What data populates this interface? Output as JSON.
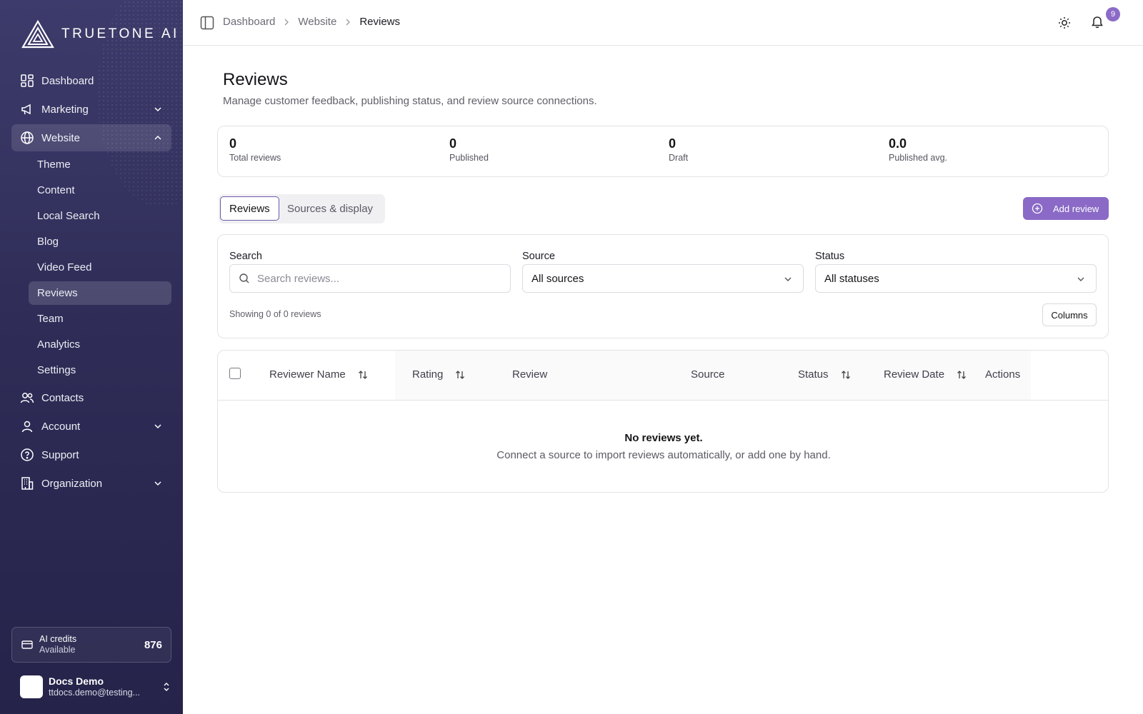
{
  "brand": {
    "name": "TRUETONE AI"
  },
  "sidebar": {
    "items": [
      {
        "label": "Dashboard",
        "icon": "dashboard-icon"
      },
      {
        "label": "Marketing",
        "icon": "megaphone-icon",
        "expandable": true
      },
      {
        "label": "Website",
        "icon": "globe-icon",
        "expandable": true,
        "expanded": true
      },
      {
        "label": "Contacts",
        "icon": "users-icon"
      },
      {
        "label": "Account",
        "icon": "user-icon",
        "expandable": true
      },
      {
        "label": "Support",
        "icon": "help-circle-icon"
      },
      {
        "label": "Organization",
        "icon": "building-icon",
        "expandable": true
      }
    ],
    "website_sub": [
      "Theme",
      "Content",
      "Local Search",
      "Blog",
      "Video Feed",
      "Reviews",
      "Team",
      "Analytics",
      "Settings"
    ],
    "active_sub": "Reviews"
  },
  "credits": {
    "title": "AI credits",
    "subtitle": "Available",
    "value": "876"
  },
  "user": {
    "name": "Docs Demo",
    "email": "ttdocs.demo@testing..."
  },
  "breadcrumb": [
    "Dashboard",
    "Website",
    "Reviews"
  ],
  "notifications": {
    "count": "9"
  },
  "page": {
    "title": "Reviews",
    "subtitle": "Manage customer feedback, publishing status, and review source connections."
  },
  "stats": [
    {
      "value": "0",
      "label": "Total reviews"
    },
    {
      "value": "0",
      "label": "Published"
    },
    {
      "value": "0",
      "label": "Draft"
    },
    {
      "value": "0.0",
      "label": "Published avg."
    }
  ],
  "tabs": [
    {
      "label": "Reviews",
      "active": true
    },
    {
      "label": "Sources & display",
      "active": false
    }
  ],
  "add_button": "Add review",
  "filters": {
    "search_label": "Search",
    "search_placeholder": "Search reviews...",
    "source_label": "Source",
    "source_value": "All sources",
    "status_label": "Status",
    "status_value": "All statuses",
    "showing": "Showing 0 of 0 reviews",
    "columns_button": "Columns"
  },
  "table": {
    "columns": [
      {
        "label": "Reviewer Name",
        "sortable": true
      },
      {
        "label": "Rating",
        "sortable": true
      },
      {
        "label": "Review",
        "sortable": false
      },
      {
        "label": "Source",
        "sortable": false
      },
      {
        "label": "Status",
        "sortable": true
      },
      {
        "label": "Review Date",
        "sortable": true
      },
      {
        "label": "Actions",
        "sortable": false
      }
    ],
    "empty_title": "No reviews yet.",
    "empty_subtitle": "Connect a source to import reviews automatically, or add one by hand."
  },
  "colors": {
    "accent": "#8a6ac6",
    "sidebar": "#2f2d57"
  }
}
